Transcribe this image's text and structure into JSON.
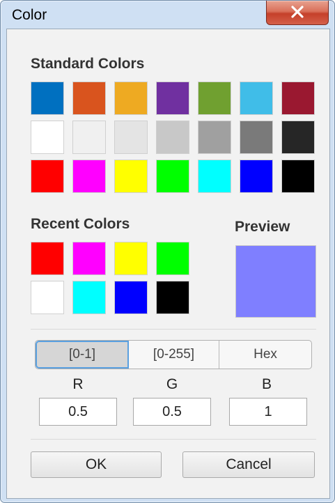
{
  "window": {
    "title": "Color"
  },
  "standard": {
    "title": "Standard Colors",
    "rows": [
      [
        "#0070c0",
        "#d9541e",
        "#eeaa22",
        "#7030a0",
        "#70a030",
        "#40bde8",
        "#9a1830"
      ],
      [
        "#ffffff",
        "#f0f0f0",
        "#e4e4e4",
        "#c8c8c8",
        "#a0a0a0",
        "#7a7a7a",
        "#262626"
      ],
      [
        "#ff0000",
        "#ff00ff",
        "#ffff00",
        "#00ff00",
        "#00ffff",
        "#0000ff",
        "#000000"
      ]
    ]
  },
  "recent": {
    "title": "Recent Colors",
    "rows": [
      [
        "#ff0000",
        "#ff00ff",
        "#ffff00",
        "#00ff00"
      ],
      [
        "#ffffff",
        "#00ffff",
        "#0000ff",
        "#000000"
      ]
    ]
  },
  "preview": {
    "title": "Preview",
    "color": "#7f7fff"
  },
  "modes": {
    "items": [
      "[0-1]",
      "[0-255]",
      "Hex"
    ],
    "active": "[0-1]"
  },
  "channels": [
    {
      "label": "R",
      "value": "0.5"
    },
    {
      "label": "G",
      "value": "0.5"
    },
    {
      "label": "B",
      "value": "1"
    }
  ],
  "buttons": {
    "ok": "OK",
    "cancel": "Cancel"
  },
  "icons": {
    "close": "close-icon"
  }
}
